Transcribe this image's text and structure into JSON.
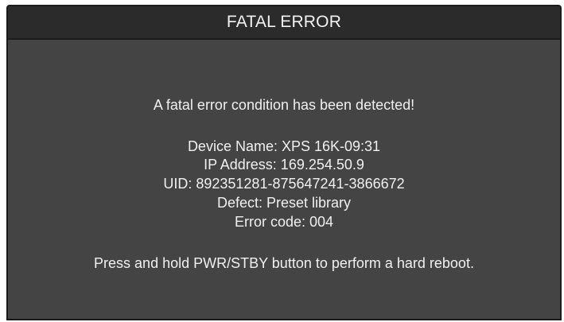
{
  "dialog": {
    "title": "FATAL ERROR",
    "message": "A fatal error condition has been detected!",
    "details": {
      "device_name": "Device Name: XPS 16K-09:31",
      "ip_address": "IP Address: 169.254.50.9",
      "uid": "UID: 892351281-875647241-3866672",
      "defect": "Defect: Preset library",
      "error_code": "Error code: 004"
    },
    "instruction": "Press and hold PWR/STBY button to perform a hard reboot."
  },
  "colors": {
    "panel_background": "#444444",
    "titlebar_background": "#2b2b2b",
    "text": "#f0f0f0"
  }
}
